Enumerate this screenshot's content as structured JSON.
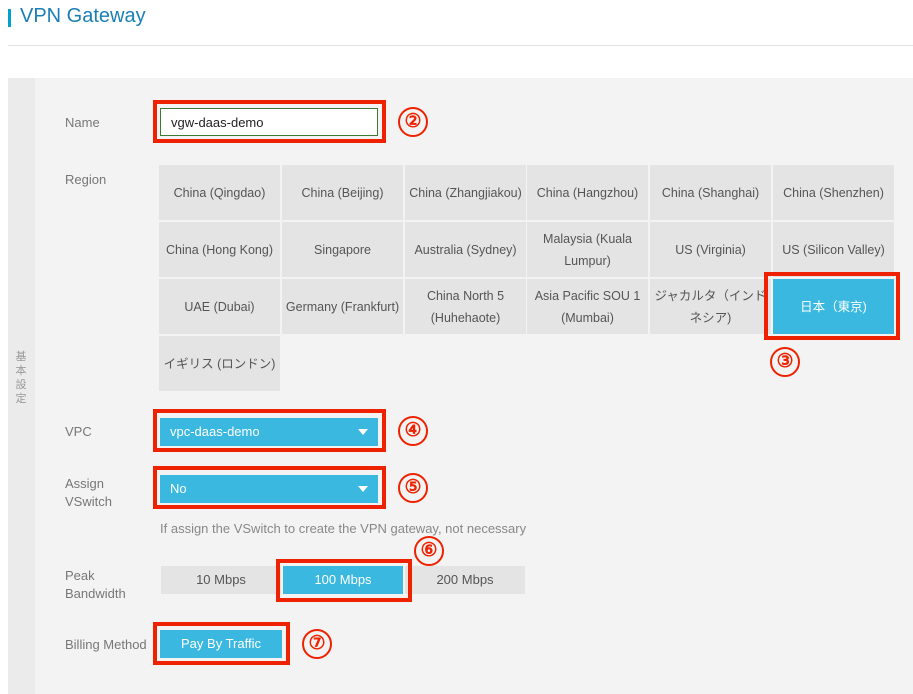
{
  "header": {
    "title": "VPN Gateway"
  },
  "section": {
    "label": "基本設定"
  },
  "form": {
    "name": {
      "label": "Name",
      "value": "vgw-daas-demo"
    },
    "region": {
      "label": "Region",
      "options": [
        "China (Qingdao)",
        "China (Beijing)",
        "China (Zhangjiakou)",
        "China (Hangzhou)",
        "China (Shanghai)",
        "China (Shenzhen)",
        "China (Hong Kong)",
        "Singapore",
        "Australia (Sydney)",
        "Malaysia (Kuala Lumpur)",
        "US (Virginia)",
        "US (Silicon Valley)",
        "UAE (Dubai)",
        "Germany (Frankfurt)",
        "China North 5 (Huhehaote)",
        "Asia Pacific SOU 1 (Mumbai)",
        "ジャカルタ（インドネシア)",
        "日本（東京)",
        "イギリス (ロンドン)"
      ],
      "selected": "日本（東京)"
    },
    "vpc": {
      "label": "VPC",
      "value": "vpc-daas-demo"
    },
    "vswitch": {
      "label_line1": "Assign",
      "label_line2": "VSwitch",
      "value": "No",
      "hint": "If assign the VSwitch to create the VPN gateway, not necessary"
    },
    "bandwidth": {
      "label_line1": "Peak",
      "label_line2": "Bandwidth",
      "options": [
        "10 Mbps",
        "100 Mbps",
        "200 Mbps"
      ],
      "selected": "100 Mbps"
    },
    "billing": {
      "label": "Billing Method",
      "value": "Pay By Traffic"
    }
  },
  "annotations": {
    "step2": "②",
    "step3": "③",
    "step4": "④",
    "step5": "⑤",
    "step6": "⑥",
    "step7": "⑦",
    "color": "#ee2200"
  },
  "colors": {
    "accent": "#3ab8df",
    "title": "#1a7fb5",
    "cell": "#e4e4e4"
  }
}
